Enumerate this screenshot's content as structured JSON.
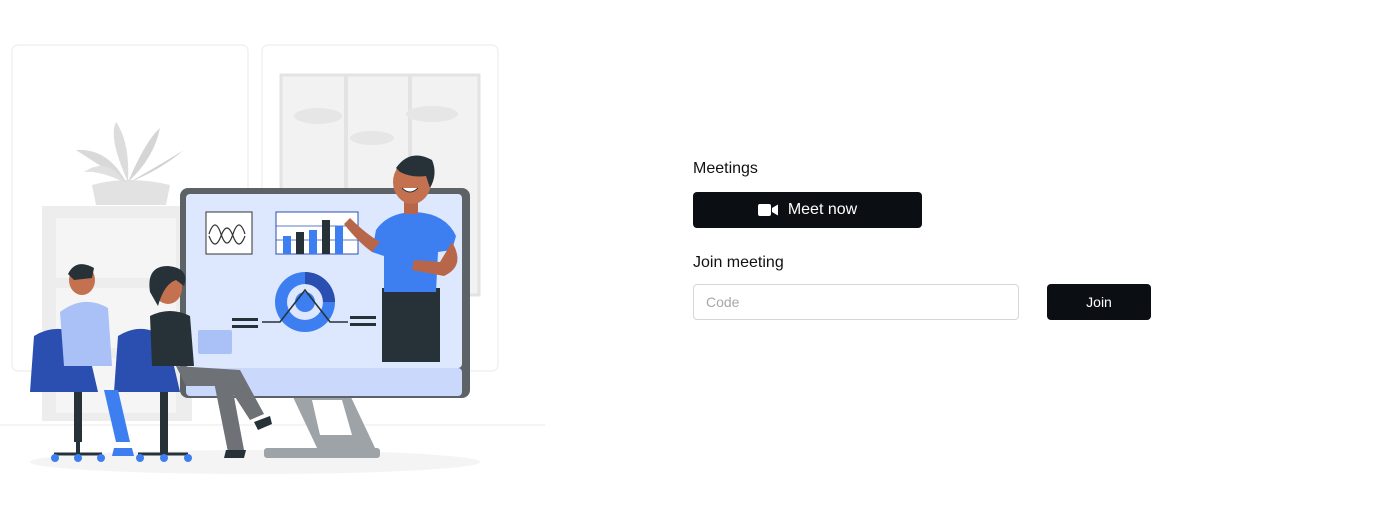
{
  "meetings": {
    "heading": "Meetings",
    "meet_now_label": "Meet now",
    "meet_now_icon": "video-camera-icon"
  },
  "join": {
    "heading": "Join meeting",
    "code_placeholder": "Code",
    "code_value": "",
    "join_label": "Join"
  },
  "illustration": {
    "subject": "team-meeting-presentation-illustration",
    "colors": {
      "accent_blue": "#3d7ff0",
      "dark_blue": "#2a4fb0",
      "light_blue": "#c9d8fb",
      "screen_bg": "#dde7fd",
      "gray": "#e9e9e9"
    }
  }
}
